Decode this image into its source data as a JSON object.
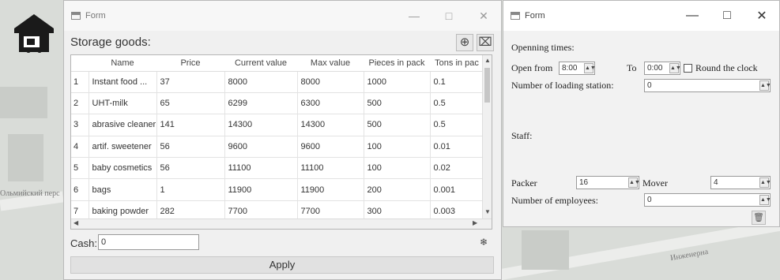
{
  "background": {
    "street_left": "Ольмийский перс",
    "street_right": "Инженерна"
  },
  "storage_window": {
    "title": "Form",
    "section_title": "Storage goods:",
    "columns": [
      "",
      "Name",
      "Price",
      "Current value",
      "Max value",
      "Pieces in pack",
      "Tons in pac"
    ],
    "rows": [
      [
        "1",
        "Instant food ...",
        "37",
        "8000",
        "8000",
        "1000",
        "0.1"
      ],
      [
        "2",
        "UHT-milk",
        "65",
        "6299",
        "6300",
        "500",
        "0.5"
      ],
      [
        "3",
        "abrasive cleaner",
        "141",
        "14300",
        "14300",
        "500",
        "0.5"
      ],
      [
        "4",
        "artif. sweetener",
        "56",
        "9600",
        "9600",
        "100",
        "0.01"
      ],
      [
        "5",
        "baby cosmetics",
        "56",
        "11100",
        "11100",
        "100",
        "0.02"
      ],
      [
        "6",
        "bags",
        "1",
        "11900",
        "11900",
        "200",
        "0.001"
      ],
      [
        "7",
        "baking powder",
        "282",
        "7700",
        "7700",
        "300",
        "0.003"
      ]
    ],
    "cash_label": "Cash:",
    "cash_value": "0",
    "apply_label": "Apply"
  },
  "settings_window": {
    "title": "Form",
    "opening_times_label": "Openning times:",
    "open_from_label": "Open from",
    "open_from_value": "8:00",
    "to_label": "To",
    "to_value": "0:00",
    "round_clock_label": "Round the clock",
    "loading_station_label": "Number of loading station:",
    "loading_station_value": "0",
    "staff_label": "Staff:",
    "packer_label": "Packer",
    "packer_value": "16",
    "mover_label": "Mover",
    "mover_value": "4",
    "employees_label": "Number of employees:",
    "employees_value": "0"
  },
  "icons": {
    "app": "warehouse-truck-icon",
    "add": "add-circle-icon",
    "remove": "remove-icon",
    "paint": "paint-bucket-icon",
    "trash": "trash-icon"
  }
}
